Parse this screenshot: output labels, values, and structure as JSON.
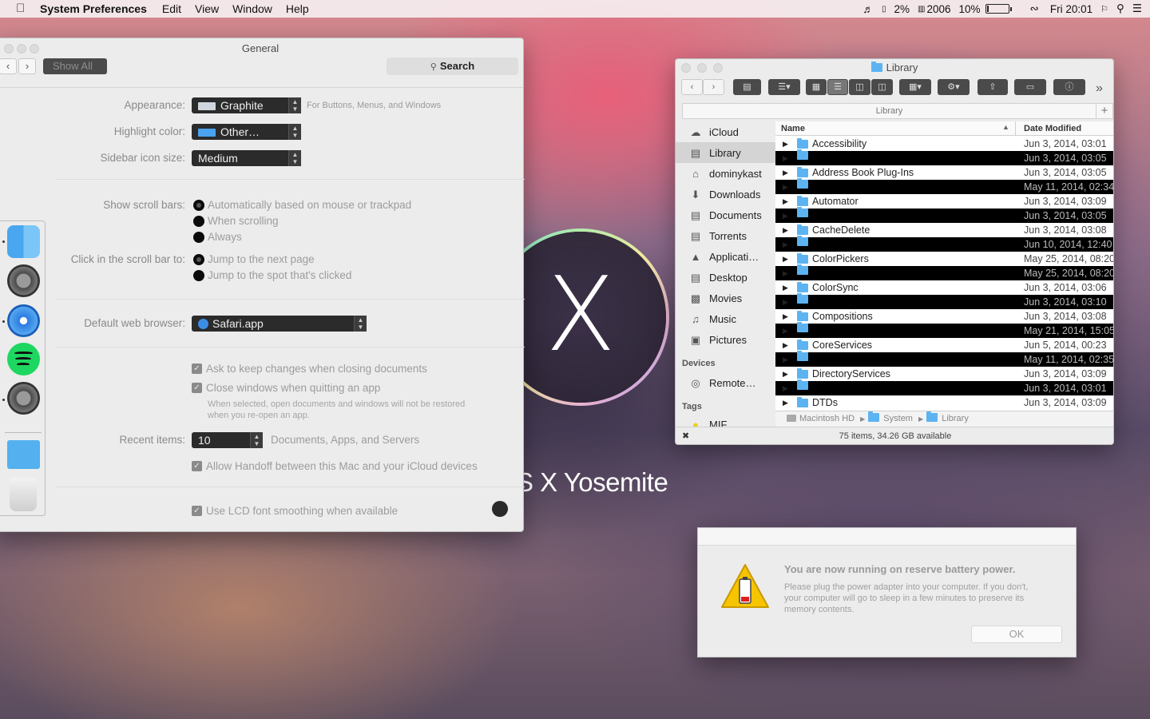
{
  "menubar": {
    "app_name": "System Preferences",
    "menus": [
      "Edit",
      "View",
      "Window",
      "Help"
    ],
    "status": {
      "cpu_percent": "2%",
      "memory": "2006",
      "battery_percent": "10%",
      "battery_level": 0.1,
      "clock": "Fri 20:01"
    }
  },
  "prefs": {
    "title": "General",
    "show_all": "Show All",
    "search": "Search",
    "appearance_label": "Appearance:",
    "appearance_value": "Graphite",
    "appearance_hint": "For Buttons, Menus, and Windows",
    "highlight_label": "Highlight color:",
    "highlight_value": "Other…",
    "sidebar_label": "Sidebar icon size:",
    "sidebar_value": "Medium",
    "scrollbars_label": "Show scroll bars:",
    "scrollbars_options": [
      "Automatically based on mouse or trackpad",
      "When scrolling",
      "Always"
    ],
    "scrollclick_label": "Click in the scroll bar to:",
    "scrollclick_options": [
      "Jump to the next page",
      "Jump to the spot that's clicked"
    ],
    "browser_label": "Default web browser:",
    "browser_value": "Safari.app",
    "ask_keep_changes": "Ask to keep changes when closing documents",
    "close_windows": "Close windows when quitting an app",
    "close_windows_note": "When selected, open documents and windows will not be restored when you re-open an app.",
    "recent_label": "Recent items:",
    "recent_value": "10",
    "recent_suffix": "Documents, Apps, and Servers",
    "handoff": "Allow Handoff between this Mac and your iCloud devices",
    "lcd_smoothing": "Use LCD font smoothing when available"
  },
  "desktop": {
    "os_name_fragment": "S X Yosemite"
  },
  "finder": {
    "title": "Library",
    "path_title": "Library",
    "sidebar": {
      "favorites": [
        "iCloud",
        "Library",
        "dominykast",
        "Downloads",
        "Documents",
        "Torrents",
        "Applicati…",
        "Desktop",
        "Movies",
        "Music",
        "Pictures"
      ],
      "devices_heading": "Devices",
      "devices": [
        "Remote…"
      ],
      "tags_heading": "Tags",
      "tags": [
        "MIF"
      ]
    },
    "columns": {
      "name": "Name",
      "date": "Date Modified"
    },
    "rows": [
      {
        "name": "Accessibility",
        "date": "Jun 3, 2014, 03:01",
        "dark": false
      },
      {
        "name": "",
        "date": "Jun 3, 2014, 03:05",
        "dark": true
      },
      {
        "name": "Address Book Plug-Ins",
        "date": "Jun 3, 2014, 03:05",
        "dark": false
      },
      {
        "name": "",
        "date": "May 11, 2014, 02:34",
        "dark": true
      },
      {
        "name": "Automator",
        "date": "Jun 3, 2014, 03:09",
        "dark": false
      },
      {
        "name": "",
        "date": "Jun 3, 2014, 03:05",
        "dark": true
      },
      {
        "name": "CacheDelete",
        "date": "Jun 3, 2014, 03:08",
        "dark": false
      },
      {
        "name": "",
        "date": "Jun 10, 2014, 12:40",
        "dark": true
      },
      {
        "name": "ColorPickers",
        "date": "May 25, 2014, 08:20",
        "dark": false
      },
      {
        "name": "",
        "date": "May 25, 2014, 08:20",
        "dark": true
      },
      {
        "name": "ColorSync",
        "date": "Jun 3, 2014, 03:06",
        "dark": false
      },
      {
        "name": "",
        "date": "Jun 3, 2014, 03:10",
        "dark": true
      },
      {
        "name": "Compositions",
        "date": "Jun 3, 2014, 03:08",
        "dark": false
      },
      {
        "name": "",
        "date": "May 21, 2014, 15:05",
        "dark": true
      },
      {
        "name": "CoreServices",
        "date": "Jun 5, 2014, 00:23",
        "dark": false
      },
      {
        "name": "",
        "date": "May 11, 2014, 02:35",
        "dark": true
      },
      {
        "name": "DirectoryServices",
        "date": "Jun 3, 2014, 03:09",
        "dark": false
      },
      {
        "name": "",
        "date": "Jun 3, 2014, 03:01",
        "dark": true
      },
      {
        "name": "DTDs",
        "date": "Jun 3, 2014, 03:09",
        "dark": false
      }
    ],
    "breadcrumbs": [
      "Macintosh HD",
      "System",
      "Library"
    ],
    "status": "75 items, 34.26 GB available"
  },
  "alert": {
    "title": "You are now running on reserve battery power.",
    "body": "Please plug the power adapter into your computer. If you don't, your computer will go to sleep in a few minutes to preserve its memory contents.",
    "ok": "OK"
  },
  "colors": {
    "highlight_swatch": "#4aa3f0",
    "folder": "#5cb3f2",
    "dark_popup": "#2b2b2b"
  }
}
